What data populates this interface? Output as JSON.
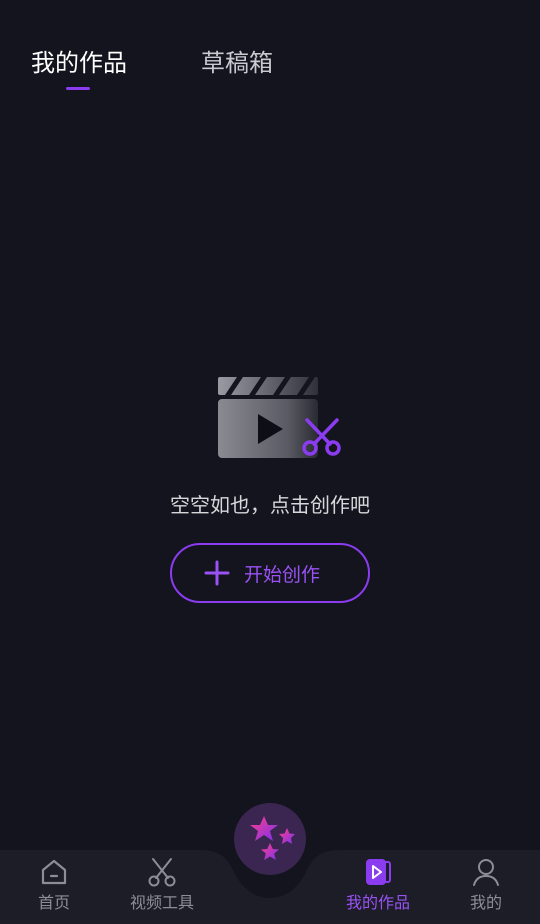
{
  "tabs": {
    "active": "我的作品",
    "drafts": "草稿箱"
  },
  "empty_state": {
    "message": "空空如也，点击创作吧",
    "button_label": "开始创作",
    "button_icon": "plus-icon",
    "illustration_icon": "clapperboard-scissors-icon"
  },
  "bottom_nav": {
    "items": [
      {
        "label": "首页",
        "icon": "home-icon"
      },
      {
        "label": "视频工具",
        "icon": "scissors-icon"
      },
      {
        "label": "我的作品",
        "icon": "video-works-icon"
      },
      {
        "label": "我的",
        "icon": "user-icon"
      }
    ],
    "center_icon": "stars-icon"
  },
  "colors": {
    "background": "#13141d",
    "accent": "#8b3cf0",
    "nav_background": "#1c1d27"
  }
}
